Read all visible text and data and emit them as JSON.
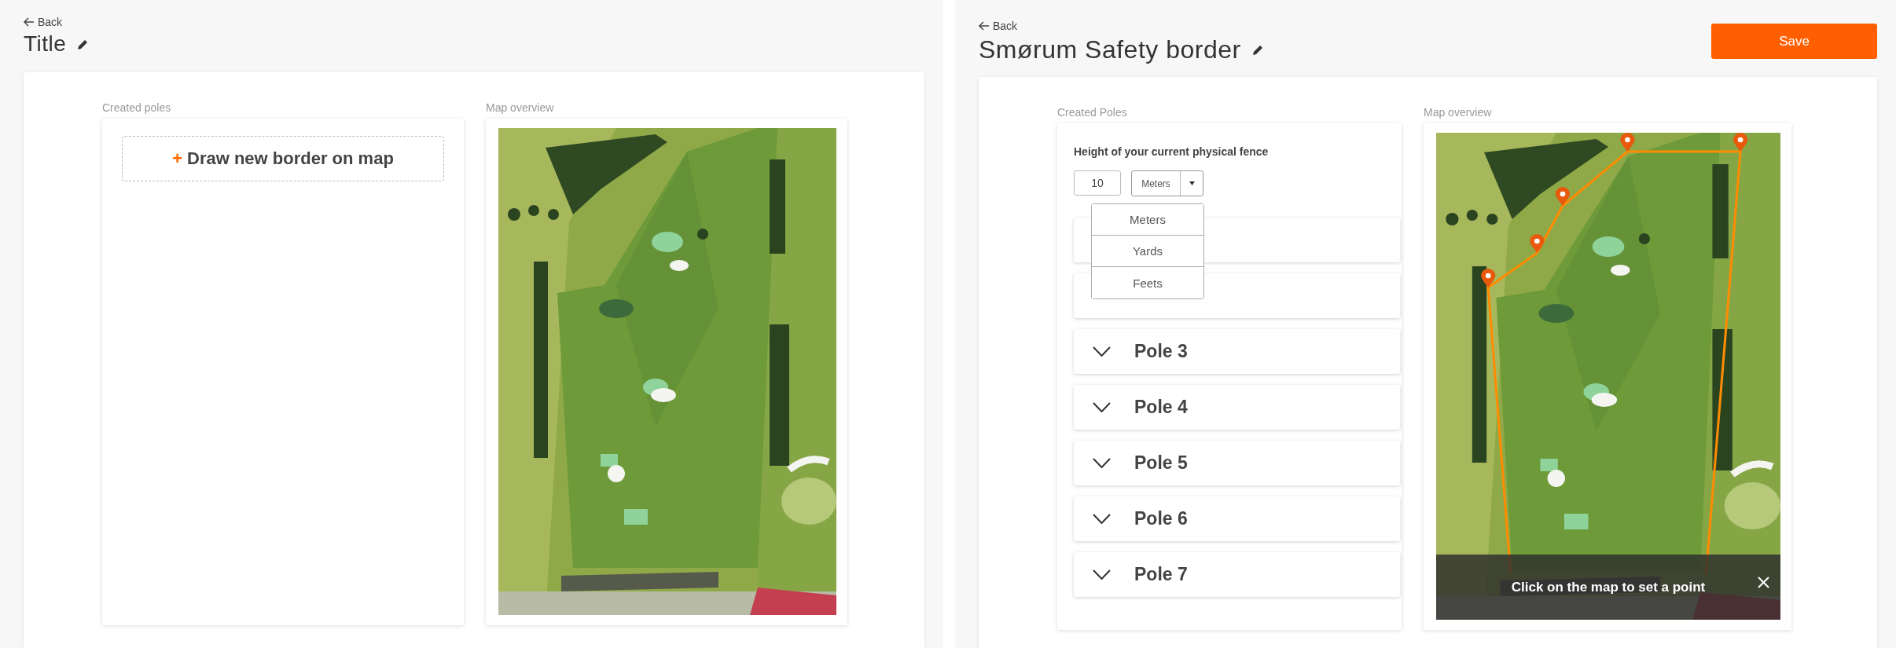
{
  "left_screen": {
    "back_link": "Back",
    "title": "Title",
    "poles_section": {
      "label": "Created poles",
      "draw_button": {
        "icon": "+",
        "label": "Draw new border on map"
      }
    },
    "map_section": {
      "label": "Map overview"
    }
  },
  "right_screen": {
    "back_link": "Back",
    "title": "Smørum Safety border",
    "save_button": "Save",
    "poles_section": {
      "label": "Created Poles",
      "fence_height": {
        "label": "Height of your current physical fence",
        "value": "10",
        "unit": "Meters",
        "unit_menu": {
          "open": true,
          "options": [
            {
              "label": "Meters"
            },
            {
              "label": "Yards"
            },
            {
              "label": "Feets"
            }
          ]
        }
      },
      "poles": [
        {
          "kind": "covered"
        },
        {
          "kind": "covered"
        },
        {
          "kind": "pole",
          "label": "Pole 3",
          "expanded": false
        },
        {
          "kind": "pole",
          "label": "Pole 4",
          "expanded": false
        },
        {
          "kind": "pole",
          "label": "Pole 5",
          "expanded": false
        },
        {
          "kind": "pole",
          "label": "Pole 6",
          "expanded": false
        },
        {
          "kind": "pole",
          "label": "Pole 7",
          "expanded": false
        }
      ]
    },
    "map_section": {
      "label": "Map overview",
      "toast": "Click on the map to set a point"
    }
  }
}
